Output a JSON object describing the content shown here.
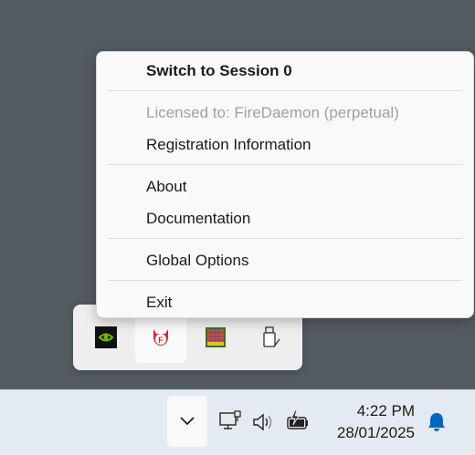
{
  "context_menu": {
    "items": [
      {
        "label": "Switch to Session 0"
      },
      {
        "label": "Licensed to: FireDaemon (perpetual)"
      },
      {
        "label": "Registration Information"
      },
      {
        "label": "About"
      },
      {
        "label": "Documentation"
      },
      {
        "label": "Global Options"
      },
      {
        "label": "Exit"
      }
    ]
  },
  "tray_overflow": {
    "icons": [
      "nvidia-icon",
      "firedaemon-icon",
      "gpu-monitor-icon",
      "usb-eject-icon"
    ]
  },
  "taskbar": {
    "show_hidden_icon": "chevron-down-icon",
    "system_icons": [
      "network-icon",
      "volume-icon",
      "battery-charging-icon"
    ],
    "clock": {
      "time": "4:22 PM",
      "date": "28/01/2025"
    },
    "notification_icon": "bell-icon"
  },
  "colors": {
    "desktop": "#525a62",
    "accent": "#0067c0",
    "firedaemon_red": "#d8262b",
    "nvidia_green": "#76b900"
  }
}
